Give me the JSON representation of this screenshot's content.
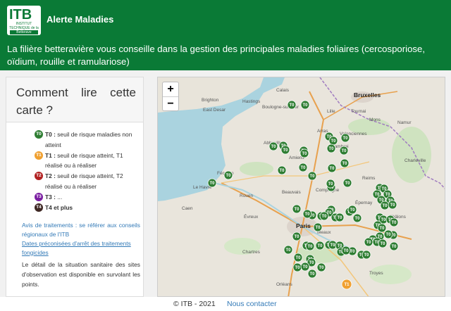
{
  "header": {
    "logo_text": "ITB",
    "logo_sub": "INSTITUT TECHNIQUE de la",
    "logo_sub2": "Betterave",
    "title": "Alerte Maladies"
  },
  "banner": {
    "text": "La filière betteravière vous conseille dans la gestion des principales maladies foliaires (cercosporiose, oïdium, rouille et ramulariose)"
  },
  "legend": {
    "title": "Comment lire cette carte ?",
    "items": [
      {
        "code": "T0",
        "label": "T0 :",
        "text": " seuil de risque maladies non atteint",
        "color": "#2e7d32"
      },
      {
        "code": "T1",
        "label": "T1 :",
        "text": " seuil de risque atteint, T1 réalisé ou à réaliser",
        "color": "#f0a030"
      },
      {
        "code": "T2",
        "label": "T2 :",
        "text": " seuil de risque atteint, T2 réalisé ou à réaliser",
        "color": "#b22222"
      },
      {
        "code": "T3",
        "label": "T3 :",
        "text": " ...",
        "color": "#7b1fa2"
      },
      {
        "code": "T4",
        "label": "T4 et plus",
        "text": "",
        "color": "#3e2723"
      }
    ],
    "advice_link": "Avis de traitements : se référer aux conseils régionaux de l'ITB",
    "dates_link": "Dates préconisées d'arrêt des traitements fongicides",
    "note": "Le détail de la situation sanitaire des sites d'observation est disponible en survolant les points."
  },
  "map": {
    "zoom_in": "+",
    "zoom_out": "−",
    "cities_big": [
      "Bruxelles",
      "Paris"
    ],
    "cities": [
      "Calais",
      "Brighton",
      "Hastings",
      "East Desar",
      "Boulogne-sur-Mer",
      "Lille",
      "Tournai",
      "Arras",
      "Valenciennes",
      "Mons",
      "Namur",
      "Abbeville",
      "Amiens",
      "Cambrai",
      "Le Havre",
      "Fécamp",
      "Rouen",
      "Beauvais",
      "Compiègne",
      "Caen",
      "Évreux",
      "Reims",
      "Meaux",
      "Chartres",
      "Troyes",
      "Orléans",
      "Charleville",
      "Épernay",
      "Châlons"
    ],
    "marker_label": "T0",
    "marker_alert_label": "T1",
    "marker_count": 76
  },
  "footer": {
    "copyright": "© ITB - 2021",
    "contact": "Nous contacter"
  }
}
